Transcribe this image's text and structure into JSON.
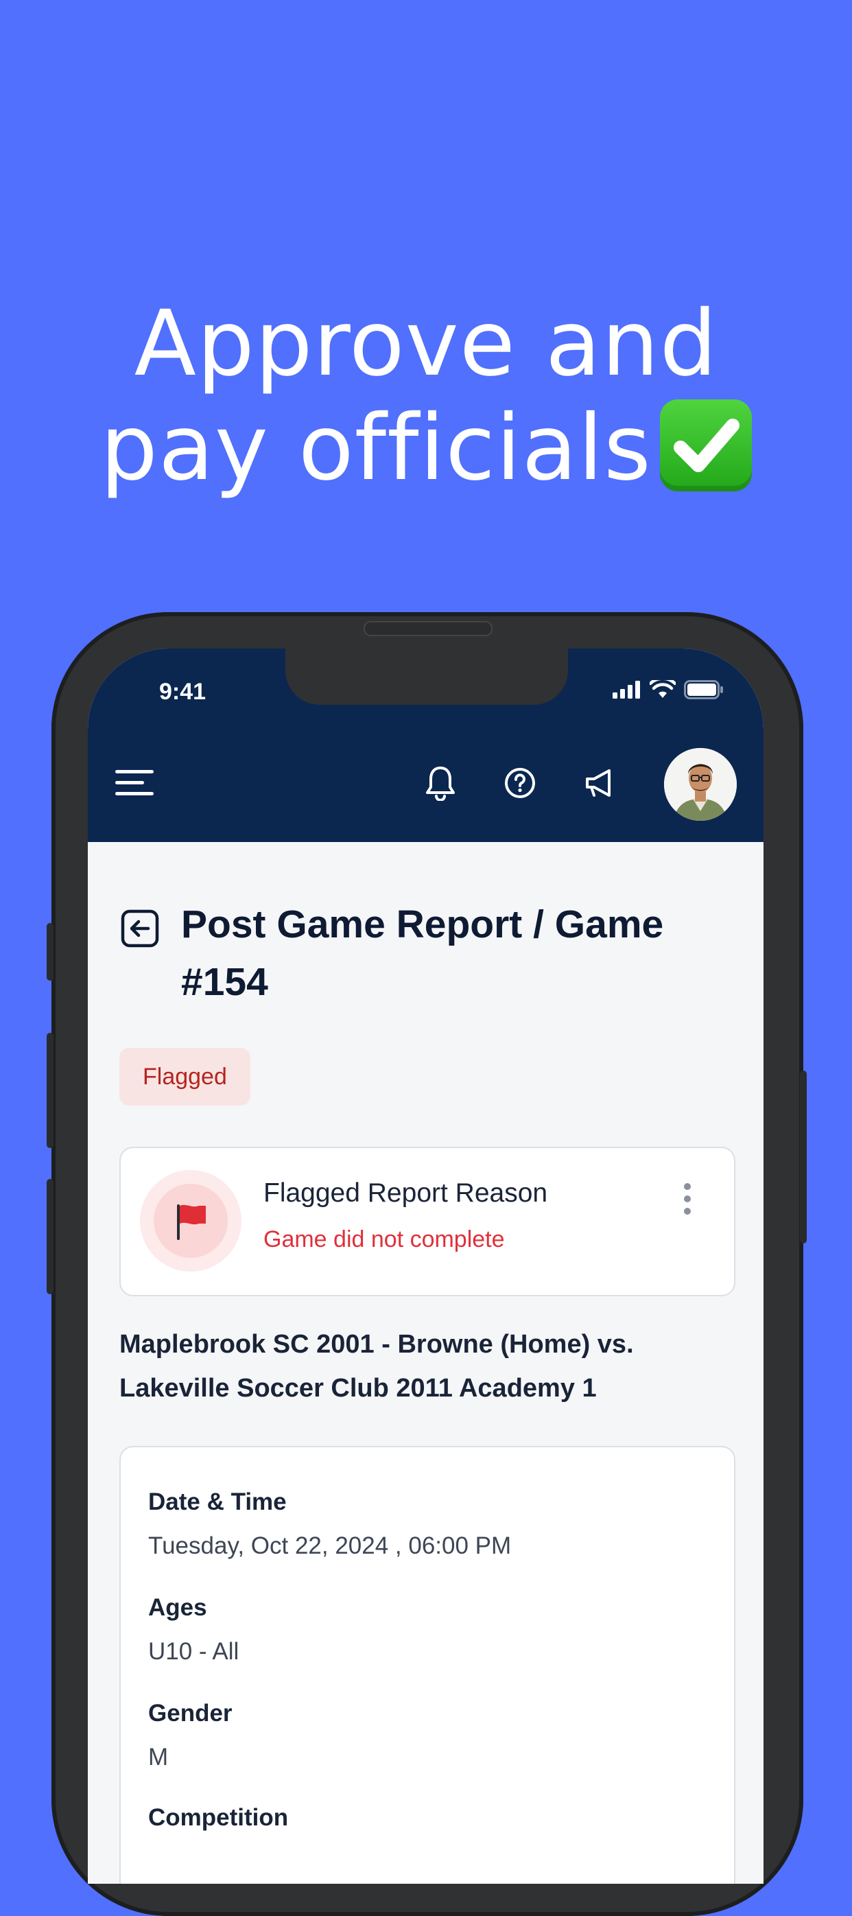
{
  "hero": {
    "line1": "Approve and",
    "line2": "pay officials",
    "check_icon": "check-mark-button-emoji"
  },
  "status_bar": {
    "time": "9:41"
  },
  "app_bar": {
    "icons": [
      "menu-icon",
      "bell-icon",
      "help-icon",
      "megaphone-icon",
      "avatar"
    ]
  },
  "page": {
    "title": "Post Game Report / Game #154",
    "badge": "Flagged",
    "flag_card": {
      "title": "Flagged Report Reason",
      "reason": "Game did not complete"
    },
    "match_title": "Maplebrook SC 2001 - Browne (Home) vs. Lakeville Soccer Club 2011 Academy 1",
    "details": [
      {
        "label": "Date & Time",
        "value": "Tuesday, Oct 22, 2024 , 06:00 PM"
      },
      {
        "label": "Ages",
        "value": "U10 - All"
      },
      {
        "label": "Gender",
        "value": "M"
      },
      {
        "label": "Competition",
        "value": ""
      }
    ]
  },
  "colors": {
    "background": "#5070fd",
    "app_bar": "#0b2750",
    "flag_red": "#e0303a",
    "badge_bg": "#f9e4e4"
  }
}
